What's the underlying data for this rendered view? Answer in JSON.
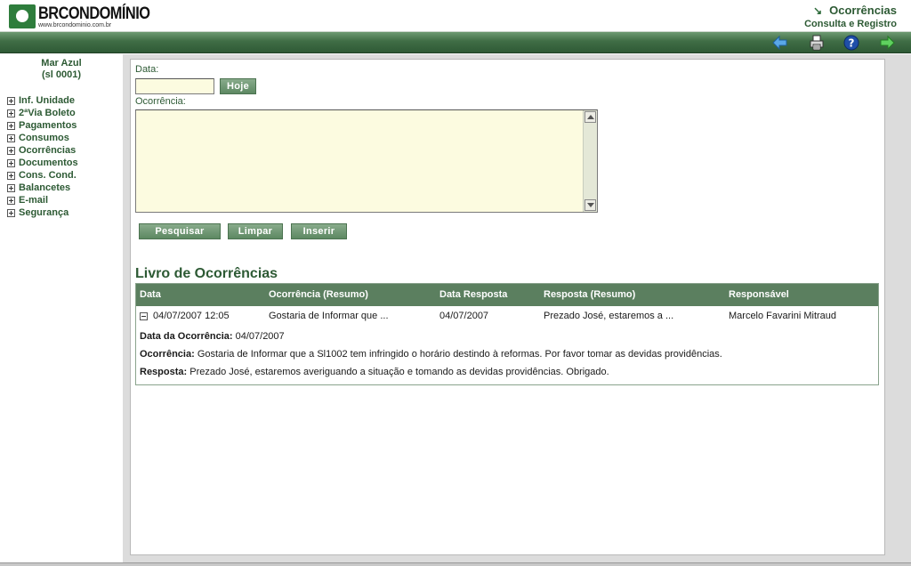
{
  "brand": {
    "name": "BRCONDOMÍNIO",
    "url": "www.brcondominio.com.br"
  },
  "page": {
    "title": "Ocorrências",
    "subtitle": "Consulta e Registro"
  },
  "toolbar": {
    "back_icon": "back-arrow-icon",
    "print_icon": "printer-icon",
    "help_icon": "help-icon",
    "forward_icon": "forward-arrow-icon"
  },
  "sidebar": {
    "unit_name": "Mar Azul",
    "unit_code": "(sl 0001)",
    "items": [
      {
        "label": "Inf. Unidade"
      },
      {
        "label": "2ªVia Boleto"
      },
      {
        "label": "Pagamentos"
      },
      {
        "label": "Consumos"
      },
      {
        "label": "Ocorrências"
      },
      {
        "label": "Documentos"
      },
      {
        "label": "Cons. Cond."
      },
      {
        "label": "Balancetes"
      },
      {
        "label": "E-mail"
      },
      {
        "label": "Segurança"
      }
    ]
  },
  "form": {
    "date_label": "Data:",
    "date_value": "",
    "today_label": "Hoje",
    "occurrence_label": "Ocorrência:",
    "occurrence_value": "",
    "search_label": "Pesquisar",
    "clear_label": "Limpar",
    "insert_label": "Inserir"
  },
  "log": {
    "title": "Livro de Ocorrências",
    "columns": [
      "Data",
      "Ocorrência (Resumo)",
      "Data Resposta",
      "Resposta (Resumo)",
      "Responsável"
    ],
    "rows": [
      {
        "date": "04/07/2007 12:05",
        "summary": "Gostaria de Informar que ...",
        "response_date": "04/07/2007",
        "response_summary": "Prezado José, estaremos a ...",
        "responsible": "Marcelo Favarini Mitraud"
      }
    ],
    "detail": {
      "date_label": "Data da Ocorrência:",
      "date_value": "04/07/2007",
      "occurrence_label": "Ocorrência:",
      "occurrence_value": "Gostaria de Informar que a Sl1002 tem infringido o horário destindo à reformas. Por favor tomar as devidas providências.",
      "response_label": "Resposta:",
      "response_value": "Prezado José, estaremos averiguando a situação e tomando as devidas providências. Obrigado."
    }
  },
  "colors": {
    "brand_green": "#2d5a34",
    "toolbar_green": "#3f6d45",
    "header_row_green": "#5b7f5f",
    "input_bg": "#fcfbe0"
  }
}
